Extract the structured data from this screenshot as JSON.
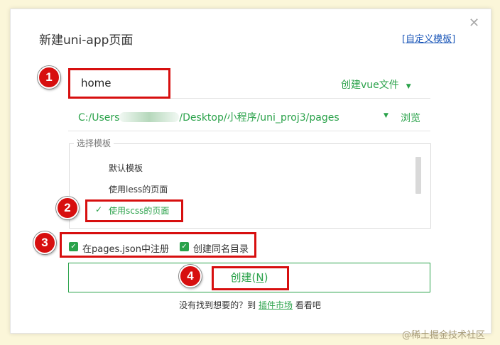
{
  "dialog": {
    "title": "新建uni-app页面",
    "custom_template_prefix": "[",
    "custom_template_label": "自定义模板",
    "custom_template_suffix": "]",
    "close_glyph": "✕"
  },
  "name_field": {
    "value": "home"
  },
  "create_type": {
    "label": "创建vue文件",
    "caret": "▼"
  },
  "path": {
    "prefix": "C:/Users",
    "suffix": "/Desktop/小程序/uni_proj3/pages",
    "caret": "▼",
    "browse_label": "浏览"
  },
  "templates": {
    "legend": "选择模板",
    "items": [
      {
        "label": "默认模板",
        "selected": false
      },
      {
        "label": "使用less的页面",
        "selected": false
      },
      {
        "label": "使用scss的页面",
        "selected": true
      }
    ],
    "check_glyph": "✓"
  },
  "options": [
    {
      "label": "在pages.json中注册",
      "checked": true
    },
    {
      "label": "创建同名目录",
      "checked": true
    }
  ],
  "create_button": {
    "label": "创建(",
    "hotkey": "N",
    "close": ")"
  },
  "footer": {
    "prefix": "没有找到想要的？到 ",
    "link": "插件市场",
    "suffix": " 看看吧"
  },
  "annotations": [
    "1",
    "2",
    "3",
    "4"
  ],
  "watermark": "@稀土掘金技术社区",
  "colors": {
    "accent": "#2aa24a",
    "annotation": "#d70f0f",
    "link": "#1a56b8",
    "background": "#fbf6d9"
  }
}
